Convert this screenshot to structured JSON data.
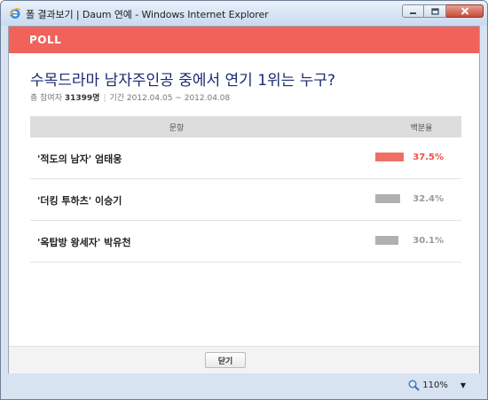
{
  "window": {
    "title": "폴 결과보기 | Daum 연예 - Windows Internet Explorer"
  },
  "poll": {
    "logo": "POLL",
    "question": "수목드라마 남자주인공 중에서 연기 1위는 누구?",
    "meta": {
      "participants_label": "총 참여자",
      "participants_count": "31399명",
      "period_label": "기간 2012.04.05 ~ 2012.04.08"
    },
    "columns": {
      "item": "문항",
      "percent": "백분율"
    },
    "rows": [
      {
        "label": "'적도의 남자' 엄태웅",
        "percent_text": "37.5%",
        "percent": 37.5,
        "top": true
      },
      {
        "label": "'더킹 투하츠' 이승기",
        "percent_text": "32.4%",
        "percent": 32.4,
        "top": false
      },
      {
        "label": "'옥탑방 왕세자' 박유천",
        "percent_text": "30.1%",
        "percent": 30.1,
        "top": false
      }
    ],
    "close_button": "닫기"
  },
  "statusbar": {
    "zoom": "110%"
  },
  "colors": {
    "accent": "#f0625a",
    "question": "#1a2a73",
    "top_bar": "#ef6f65",
    "bar": "#b0b0b0"
  },
  "icons": [
    "ie-icon",
    "minimize-icon",
    "maximize-icon",
    "close-icon",
    "zoom-icon",
    "chevron-down-icon"
  ]
}
